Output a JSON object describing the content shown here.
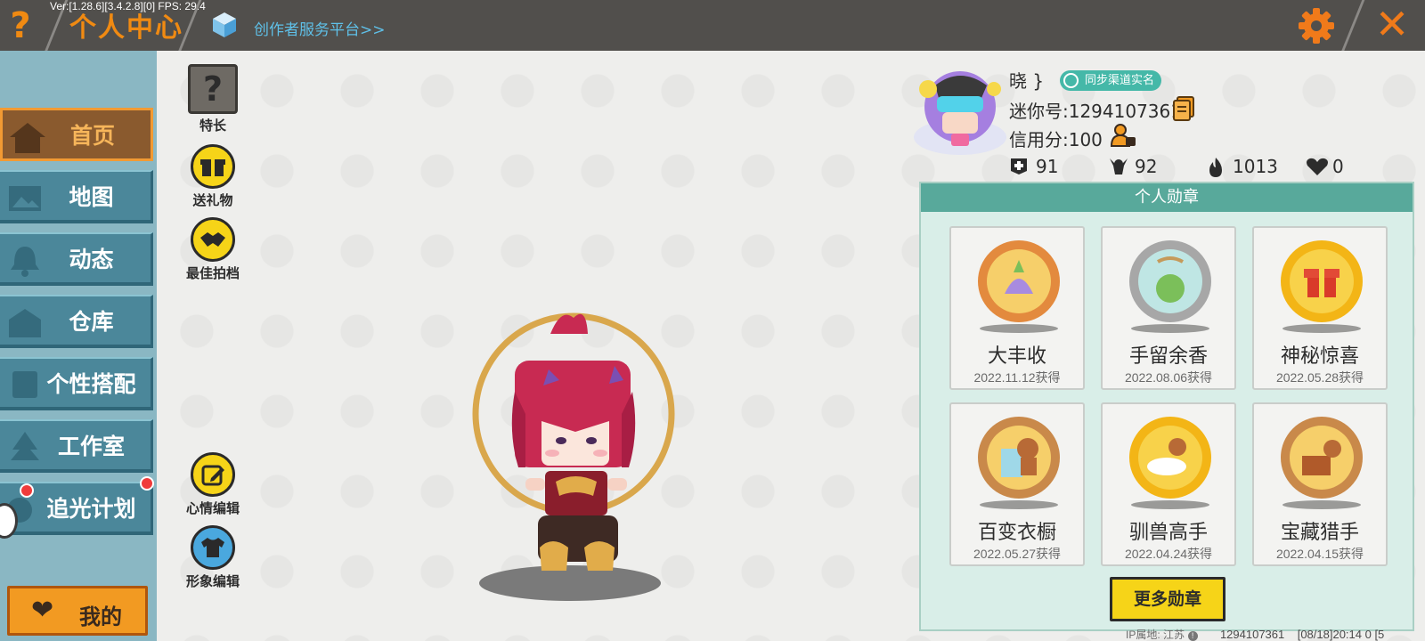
{
  "app": {
    "debug_info": "Ver:[1.28.6][3.4.2.8][0] FPS: 29.4",
    "title": "个人中心",
    "creator_link": "创作者服务平台>>"
  },
  "sidebar": {
    "items": [
      {
        "label": "首页",
        "active": true
      },
      {
        "label": "地图",
        "active": false
      },
      {
        "label": "动态",
        "active": false
      },
      {
        "label": "仓库",
        "active": false
      },
      {
        "label": "个性搭配",
        "active": false
      },
      {
        "label": "工作室",
        "active": false
      },
      {
        "label": "追光计划",
        "active": false
      }
    ],
    "mine_label": "我的"
  },
  "actions": {
    "talent": "特长",
    "send_gift": "送礼物",
    "best_partner": "最佳拍档",
    "mood_edit": "心情编辑",
    "avatar_edit": "形象编辑"
  },
  "profile": {
    "username": "晓 }",
    "sync_label": "同步渠道实名",
    "mini_id": "迷你号:1294107361",
    "credit": "信用分:100",
    "stats": {
      "likes": "91",
      "followers": "92",
      "heat": "1013",
      "favorites": "0"
    }
  },
  "badges": {
    "header": "个人勋章",
    "items": [
      {
        "name": "大丰收",
        "date": "2022.11.12获得"
      },
      {
        "name": "手留余香",
        "date": "2022.08.06获得"
      },
      {
        "name": "神秘惊喜",
        "date": "2022.05.28获得"
      },
      {
        "name": "百变衣橱",
        "date": "2022.05.27获得"
      },
      {
        "name": "驯兽高手",
        "date": "2022.04.24获得"
      },
      {
        "name": "宝藏猎手",
        "date": "2022.04.15获得"
      }
    ],
    "more_label": "更多勋章"
  },
  "footer": {
    "ip_location": "IP属地: 江苏",
    "uid": "1294107361",
    "time": "[08/18]20:14 0 [5"
  },
  "colors": {
    "accent_orange": "#f08a12",
    "topbar": "#514f4c",
    "sidebar_item": "#4b879a",
    "badge_header": "#58a99b",
    "button_yellow": "#f6d418"
  }
}
